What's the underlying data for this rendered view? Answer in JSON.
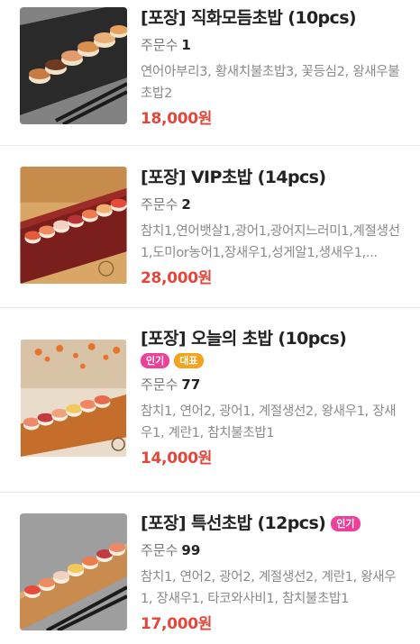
{
  "menu_items": [
    {
      "title": "[포장] 직화모듬초밥 (10pcs)",
      "order_label": "주문수",
      "order_count": "1",
      "badges": [],
      "description": "연어아부리3, 황새치불초밥3, 꽃등심2, 왕새우불초밥2",
      "price": "18,000원"
    },
    {
      "title": "[포장] VIP초밥 (14pcs)",
      "order_label": "주문수",
      "order_count": "2",
      "badges": [],
      "description": "참치1,연어뱃살1,광어1,광어지느러미1,계절생선1,도미or농어1,장새우1,성게알1,생새우1,...",
      "price": "28,000원"
    },
    {
      "title": "[포장] 오늘의 초밥 (10pcs)",
      "order_label": "주문수",
      "order_count": "77",
      "badges": [
        "인기",
        "대표"
      ],
      "description": "참치1, 연어2, 광어1, 계절생선2, 왕새우1, 장새우1, 계란1, 참치불초밥1",
      "price": "14,000원"
    },
    {
      "title": "[포장] 특선초밥 (12pcs)",
      "order_label": "주문수",
      "order_count": "99",
      "badges": [
        "인기"
      ],
      "description": "참치1, 연어2, 광어2, 계절생선2, 계란1, 왕새우1, 장새우1, 타코와사비1, 참치불초밥1",
      "price": "17,000원"
    }
  ],
  "colors": {
    "price": "#e2473b",
    "badge_popular": "#ee3f9a",
    "badge_signature": "#f5a21c"
  },
  "icons": [
    "sushi-platter-photo"
  ]
}
